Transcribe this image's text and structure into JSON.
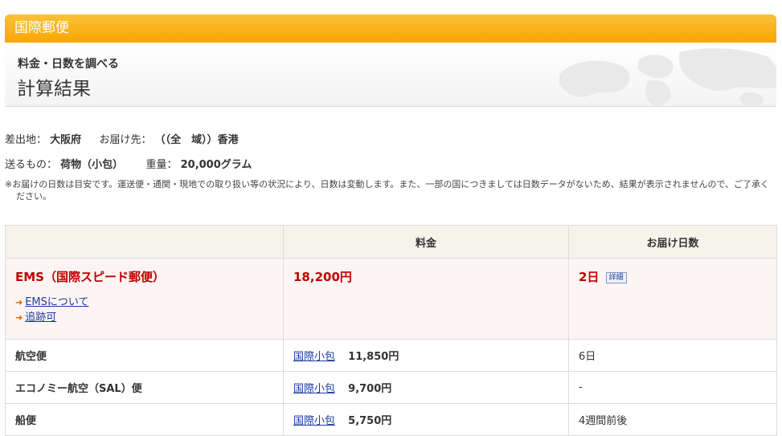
{
  "header": {
    "title": "国際郵便"
  },
  "page": {
    "subtitle": "料金・日数を調べる",
    "title": "計算結果"
  },
  "shipment": {
    "origin_label": "差出地：",
    "origin_value": "大阪府",
    "destination_label": "お届け先：",
    "destination_value": "（（全　域））香港",
    "item_label": "送るもの：",
    "item_value": "荷物（小包）",
    "weight_label": "重量：",
    "weight_value": "20,000グラム"
  },
  "notice": "※お届けの日数は目安です。運送便・通関・現地での取り扱い等の状況により、日数は変動します。また、一部の国につきましては日数データがないため、結果が表示されませんので、ご了承ください。",
  "table": {
    "headers": [
      "",
      "料金",
      "お届け日数"
    ],
    "ems": {
      "name": "EMS（国際スピード郵便）",
      "link_about": "EMSについて",
      "link_tracking": "追跡可",
      "price": "18,200円",
      "days": "2日",
      "detail_label": "詳細"
    },
    "rows": [
      {
        "mode": "航空便",
        "type": "国際小包",
        "price": "11,850円",
        "days": "6日"
      },
      {
        "mode": "エコノミー航空（SAL）便",
        "type": "国際小包",
        "price": "9,700円",
        "days": "-"
      },
      {
        "mode": "船便",
        "type": "国際小包",
        "price": "5,750円",
        "days": "4週間前後"
      }
    ]
  },
  "colors": {
    "header_orange": "#f7a700",
    "ems_red": "#c00000",
    "link_blue": "#1a3d9a"
  }
}
